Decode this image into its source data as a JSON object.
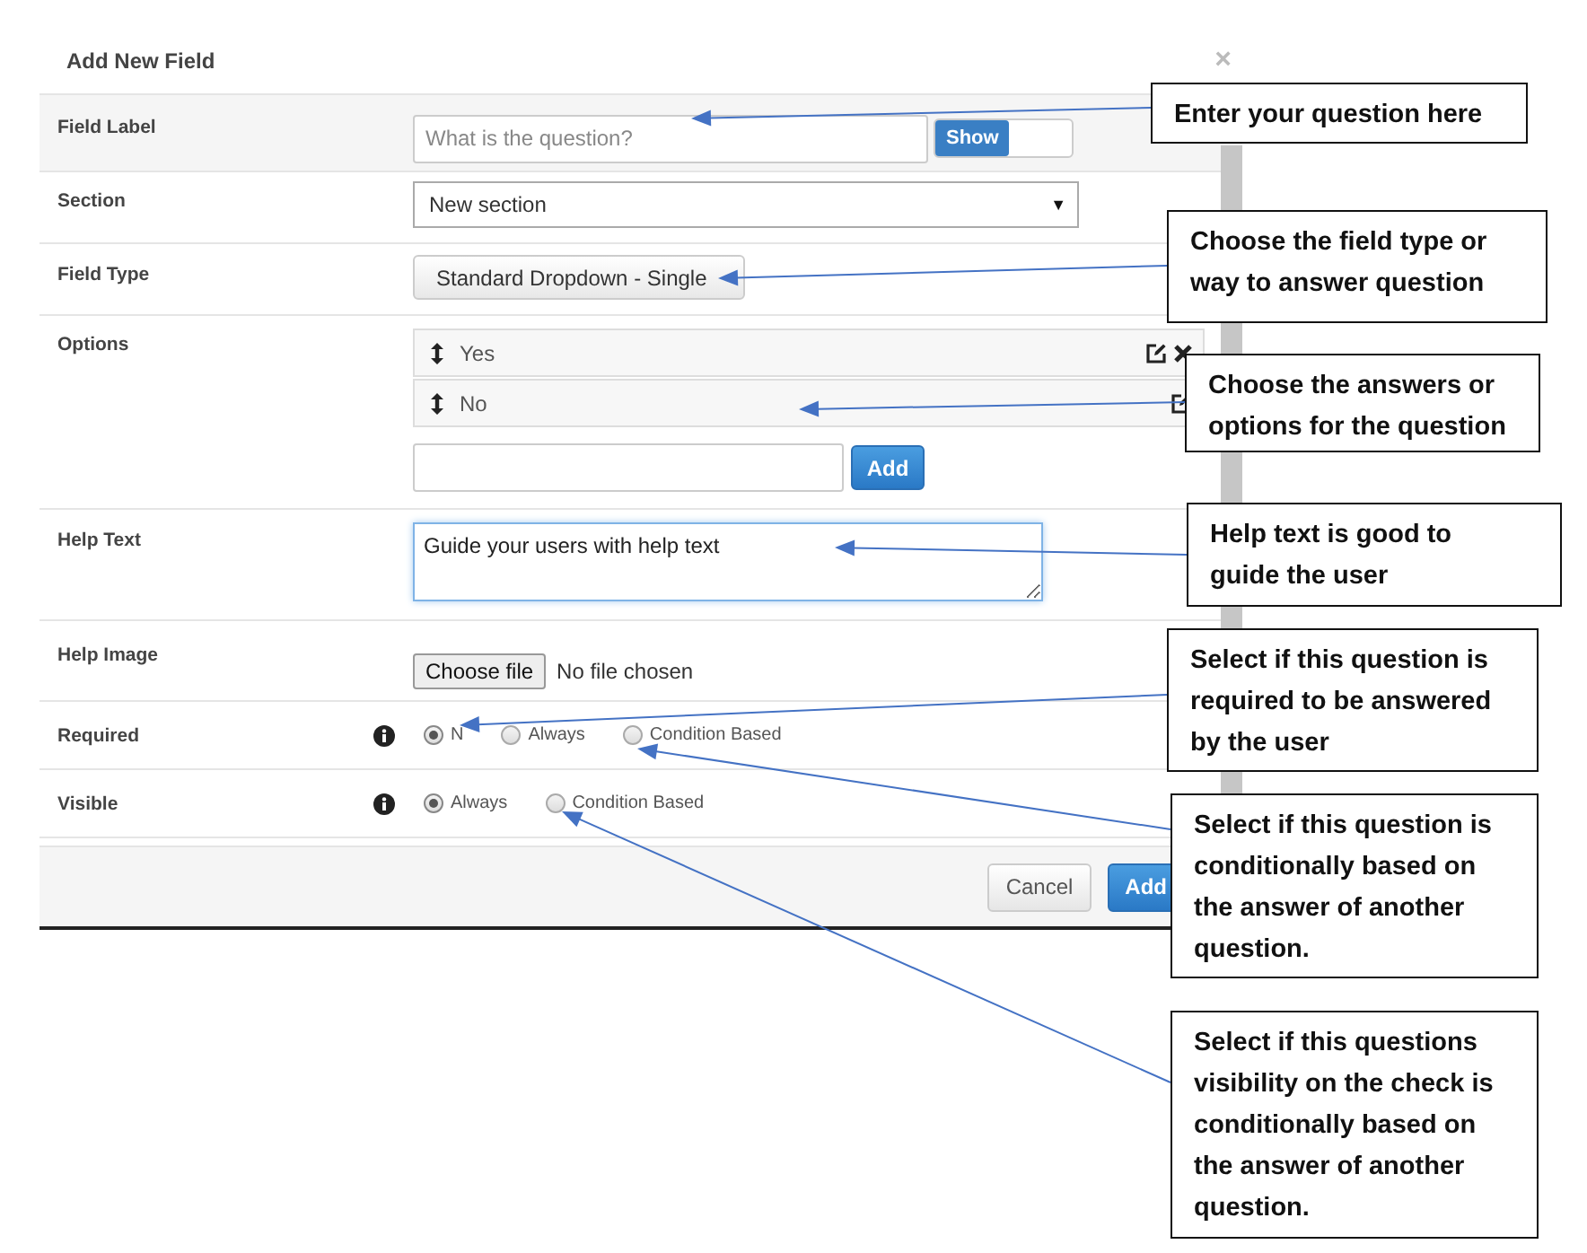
{
  "dialog": {
    "title": "Add New Field",
    "close_glyph": "×",
    "field_label": {
      "label": "Field Label",
      "placeholder": "What is the question?",
      "toggle": {
        "label": "Show",
        "on": true
      }
    },
    "section": {
      "label": "Section",
      "value": "New section",
      "caret": "▼"
    },
    "field_type": {
      "label": "Field Type",
      "value": "Standard Dropdown - Single"
    },
    "options": {
      "label": "Options",
      "items": [
        {
          "text": "Yes",
          "actions": [
            {
              "kind": "edit"
            },
            {
              "kind": "delete"
            }
          ]
        },
        {
          "text": "No",
          "actions": [
            {
              "kind": "edit"
            }
          ]
        }
      ],
      "add_button": "Add"
    },
    "help_text": {
      "label": "Help Text",
      "value": "Guide your users with help text"
    },
    "help_image": {
      "label": "Help Image",
      "button": "Choose file",
      "status": "No file chosen"
    },
    "radio_groups": [
      {
        "label": "Required",
        "options": [
          {
            "label": "N",
            "selected": true
          },
          {
            "label": "Always",
            "selected": false
          },
          {
            "label": "Condition Based",
            "selected": false
          }
        ]
      },
      {
        "label": "Visible",
        "options": [
          {
            "label": "Always",
            "selected": true
          },
          {
            "label": "Condition Based",
            "selected": false
          }
        ]
      }
    ],
    "footer_buttons": [
      {
        "label": "Cancel",
        "kind": "default"
      },
      {
        "label": "Add",
        "kind": "primary"
      }
    ]
  },
  "annotations": [
    {
      "text": "Enter your question here"
    },
    {
      "text": "Choose the field type or way to answer question"
    },
    {
      "text": "Choose the answers or options for the question"
    },
    {
      "text": "Help text is good to guide the user"
    },
    {
      "text": "Select if this question is required to be answered by the user"
    },
    {
      "text": "Select if this question is conditionally based on the answer of another question."
    },
    {
      "text": "Select if this questions visibility on the check is conditionally based on the answer of another question."
    }
  ]
}
